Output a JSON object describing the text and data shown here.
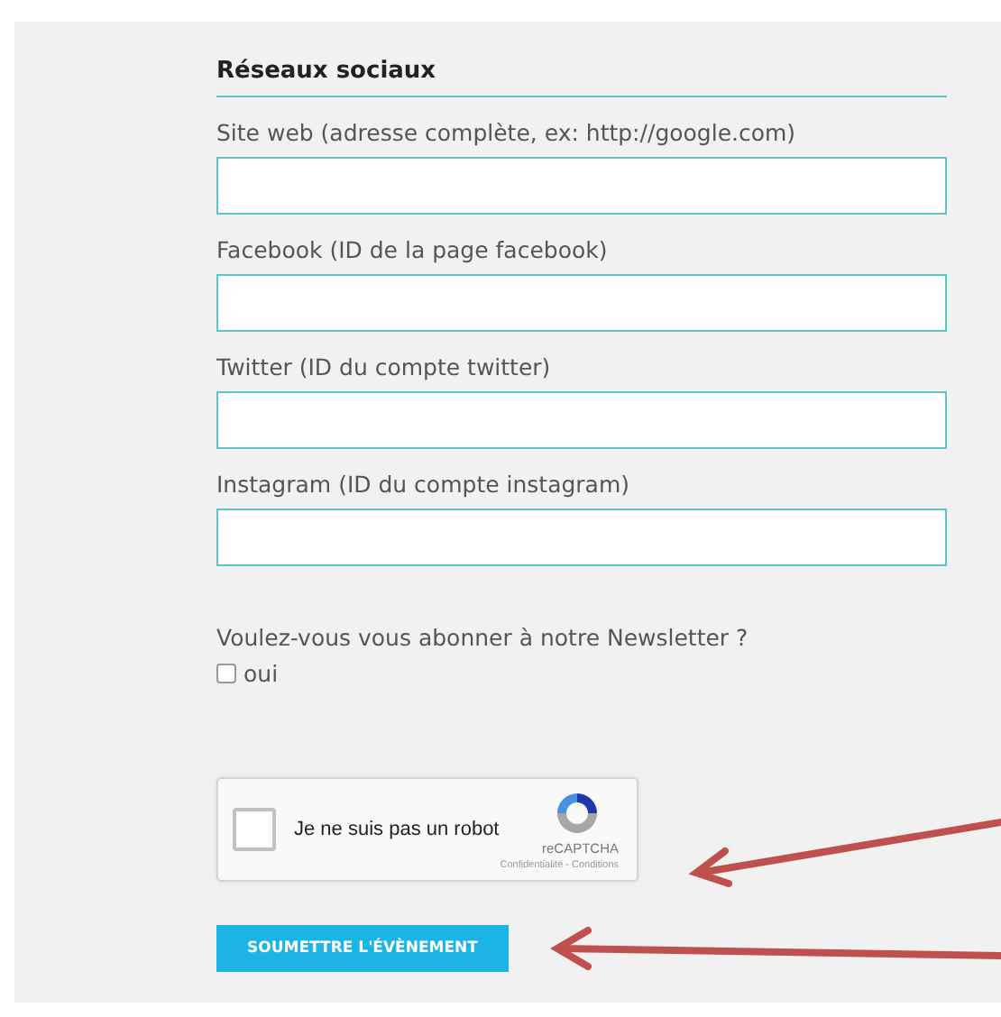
{
  "section": {
    "title": "Réseaux sociaux"
  },
  "fields": [
    {
      "label": "Site web (adresse complète, ex: http://google.com)"
    },
    {
      "label": "Facebook (ID de la page facebook)"
    },
    {
      "label": "Twitter (ID du compte twitter)"
    },
    {
      "label": "Instagram (ID du compte instagram)"
    }
  ],
  "newsletter": {
    "question": "Voulez-vous vous abonner à notre Newsletter ?",
    "option": "oui",
    "checked": false
  },
  "captcha": {
    "label": "Je ne suis pas un robot",
    "checked": false,
    "brand": "reCAPTCHA",
    "links": "Confidentialité - Conditions"
  },
  "submit": {
    "label": "SOUMETTRE L'ÉVÈNEMENT"
  }
}
